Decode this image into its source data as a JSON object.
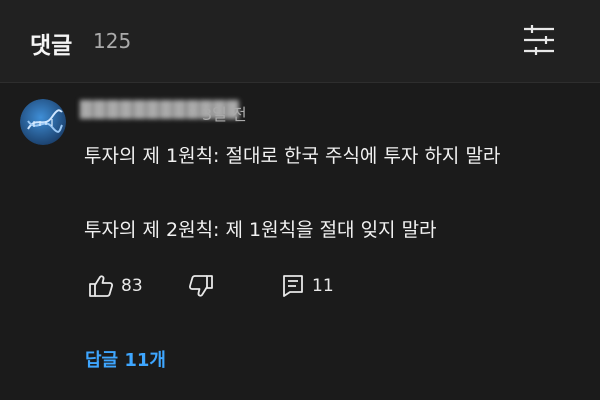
{
  "header": {
    "title": "댓글",
    "count": "125"
  },
  "comment": {
    "author": "████████████",
    "separator": "•",
    "timestamp": "3일 전",
    "lines": [
      "투자의 제 1원칙: 절대로 한국 주식에 투자 하지 말라",
      "투자의 제 2원칙: 제 1원칙을 절대 잊지 말라"
    ],
    "like_count": "83",
    "reply_count": "11",
    "view_replies_label": "답글 11개"
  },
  "icons": {
    "filter": "filter-icon",
    "like": "thumbs-up-icon",
    "dislike": "thumbs-down-icon",
    "reply": "comment-reply-icon",
    "avatar": "dna-avatar"
  },
  "colors": {
    "background": "#1f1f1f",
    "link": "#3ea6ff",
    "muted": "#aaaaaa"
  }
}
